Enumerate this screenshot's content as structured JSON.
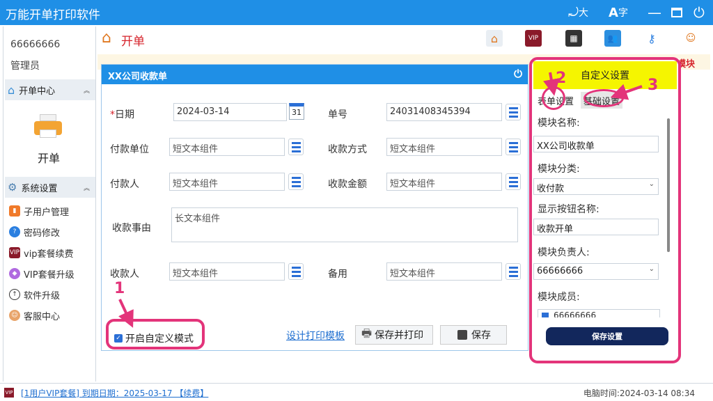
{
  "app": {
    "title": "万能开单打印软件",
    "font_big": "大",
    "font_char": "字"
  },
  "user": {
    "id": "66666666",
    "role": "管理员"
  },
  "sidebar": {
    "section1": "开单中心",
    "open_order": "开单",
    "section2": "系统设置",
    "items": [
      {
        "label": "子用户管理",
        "icon": "user-manage-icon"
      },
      {
        "label": "密码修改",
        "icon": "question-icon"
      },
      {
        "label": "vip套餐续费",
        "icon": "vip-icon"
      },
      {
        "label": "VIP套餐升级",
        "icon": "diamond-icon"
      },
      {
        "label": "软件升级",
        "icon": "upgrade-icon"
      },
      {
        "label": "客服中心",
        "icon": "support-icon"
      }
    ]
  },
  "header": {
    "title": "开单",
    "strip_right": "模块"
  },
  "form": {
    "title": "XX公司收款单",
    "date_label": "日期",
    "date_value": "2024-03-14",
    "calendar_day": "31",
    "order_no_label": "单号",
    "order_no_value": "24031408345394",
    "payer_unit_label": "付款单位",
    "payer_unit_value": "短文本组件",
    "pay_method_label": "收款方式",
    "pay_method_value": "短文本组件",
    "payer_label": "付款人",
    "payer_value": "短文本组件",
    "amount_label": "收款金额",
    "amount_value": "短文本组件",
    "reason_label": "收款事由",
    "reason_value": "长文本组件",
    "receiver_label": "收款人",
    "receiver_value": "短文本组件",
    "backup_label": "备用",
    "backup_value": "短文本组件",
    "custom_mode_label": "开启自定义模式",
    "design_link": "设计打印模板",
    "save_print": "保存并打印",
    "save": "保存"
  },
  "custom": {
    "title": "自定义设置",
    "tab1": "表单设置",
    "tab2": "基础设置",
    "module_name_label": "模块名称:",
    "module_name_value": "XX公司收款单",
    "module_cat_label": "模块分类:",
    "module_cat_value": "收付款",
    "button_name_label": "显示按钮名称:",
    "button_name_value": "收款开单",
    "owner_label": "模块负责人:",
    "owner_value": "66666666",
    "members_label": "模块成员:",
    "member_value": "66666666",
    "save_button": "保存设置"
  },
  "markers": {
    "m1": "1",
    "m2": "2",
    "m3": "3"
  },
  "status": {
    "vip_text": "[1用户VIP套餐] 到期日期：2025-03-17 【续费】",
    "time": "电脑时间:2024-03-14 08:34"
  },
  "colors": {
    "titlebar": "#1f8fe6",
    "accent_red": "#d6232b",
    "annotation": "#e3347a",
    "highlight": "#f5f500",
    "save_btn": "#12275c"
  }
}
